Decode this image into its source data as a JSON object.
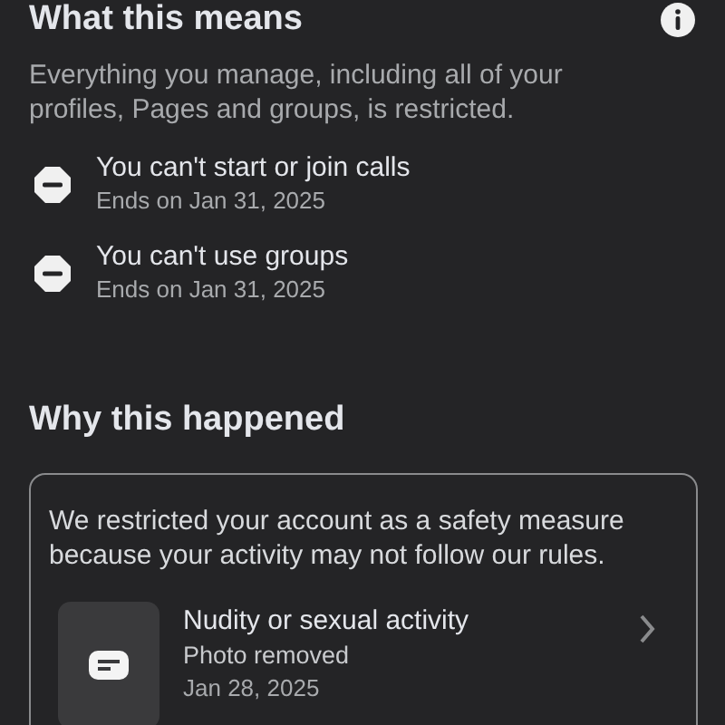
{
  "sections": [
    {
      "title": "What this means",
      "description": "Everything you manage, including all of your profiles, Pages and groups, is restricted.",
      "restrictions": [
        {
          "title": "You can't start or join calls",
          "subtitle": "Ends on Jan 31, 2025"
        },
        {
          "title": "You can't use groups",
          "subtitle": "Ends on Jan 31, 2025"
        }
      ]
    },
    {
      "title": "Why this happened",
      "card": {
        "text": "We restricted your account as a safety measure because your activity may not follow our rules.",
        "violation": {
          "title": "Nudity or sexual activity",
          "action": "Photo removed",
          "date": "Jan 28, 2025"
        }
      }
    }
  ]
}
